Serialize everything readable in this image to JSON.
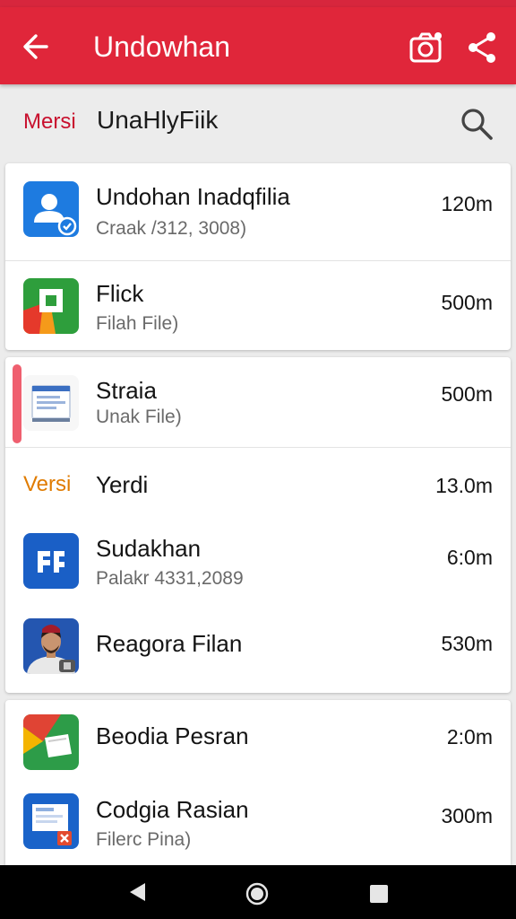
{
  "app_bar": {
    "title": "Undowhan",
    "back_icon": "arrow-back-icon",
    "camera_icon": "camera-icon",
    "share_icon": "share-icon",
    "color": "#e0263a"
  },
  "search": {
    "prefix": "Mersi",
    "query": "UnaHlyFiik",
    "icon": "search-icon"
  },
  "card1": {
    "items": [
      {
        "name": "Undohan Inadqfilia",
        "subtitle": "Craak /312, 3008)",
        "size": "120m",
        "icon": "contact-doc-icon"
      },
      {
        "name": "Flick",
        "subtitle": "Filah File)",
        "size": "500m",
        "icon": "green-app-icon"
      }
    ]
  },
  "card2": {
    "items": [
      {
        "name": "Straia",
        "subtitle": "Unak File)",
        "size": "500m",
        "icon": "document-icon"
      }
    ],
    "section_label": "Versi",
    "section_item": {
      "name": "Yerdi",
      "size": "13.0m"
    },
    "items2": [
      {
        "name": "Sudakhan",
        "subtitle": "Palakr 4331,2089",
        "size": "6:0m",
        "icon": "blue-app-icon"
      },
      {
        "name": "Reagora Filan",
        "size": "530m",
        "icon": "avatar-icon"
      }
    ]
  },
  "card3": {
    "items": [
      {
        "name": "Beodia Pesran",
        "size": "2:0m",
        "icon": "slides-icon"
      },
      {
        "name": "Codgia Rasian",
        "subtitle": "Filerc Pina)",
        "size": "300m",
        "icon": "presentation-icon"
      }
    ]
  },
  "nav": {
    "back": "nav-back-icon",
    "home": "nav-home-icon",
    "recents": "nav-recents-icon"
  }
}
